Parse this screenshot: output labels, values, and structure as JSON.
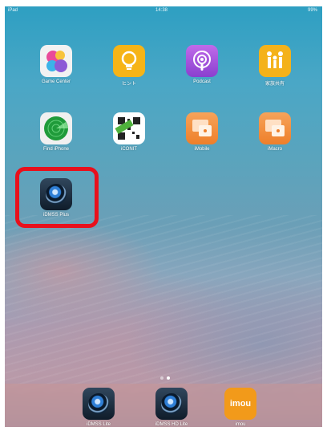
{
  "status_bar": {
    "carrier": "iPad",
    "time": "14:38",
    "battery": "99%"
  },
  "home": {
    "apps": [
      {
        "label": "Game Center",
        "icon": "game-center-icon"
      },
      {
        "label": "ヒント",
        "icon": "tips-icon"
      },
      {
        "label": "Podcast",
        "icon": "podcast-icon"
      },
      {
        "label": "家族共有",
        "icon": "family-sharing-icon"
      },
      {
        "label": "Find iPhone",
        "icon": "find-iphone-icon"
      },
      {
        "label": "iCONIT",
        "icon": "iconit-qr-icon"
      },
      {
        "label": "iMobile",
        "icon": "imobile-icon"
      },
      {
        "label": "iMacro",
        "icon": "imacro-icon"
      },
      {
        "label": "iDMSS Plus",
        "icon": "idmss-plus-camera-icon"
      }
    ]
  },
  "dock": {
    "apps": [
      {
        "label": "iDMSS Lite",
        "icon": "idmss-lite-camera-icon"
      },
      {
        "label": "iDMSS HD Lite",
        "icon": "idmss-hd-lite-camera-icon"
      },
      {
        "label": "imou",
        "icon": "imou-icon",
        "brand_text": "imou"
      }
    ]
  },
  "colors": {
    "highlight": "#e8101c",
    "imou_orange": "#f29a1a"
  }
}
